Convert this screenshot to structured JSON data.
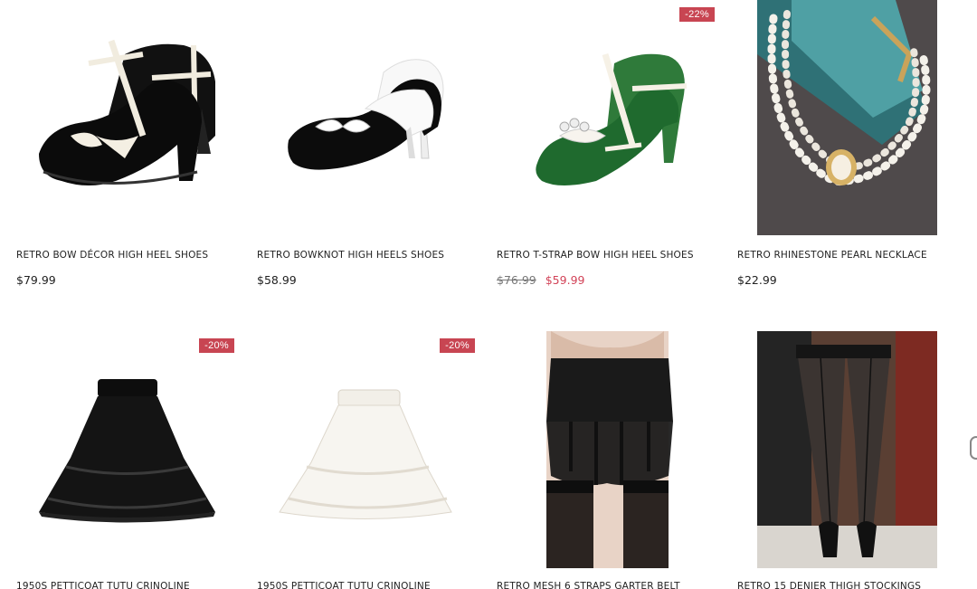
{
  "products": [
    {
      "title": "RETRO BOW DÉCOR HIGH HEEL SHOES",
      "price": "$79.99",
      "image": "black-cream-tstrap-heels"
    },
    {
      "title": "RETRO BOWKNOT HIGH HEELS SHOES",
      "price": "$58.99",
      "image": "black-white-bow-pumps"
    },
    {
      "title": "RETRO T-STRAP BOW HIGH HEEL SHOES",
      "old_price": "$76.99",
      "sale_price": "$59.99",
      "badge": "-22%",
      "image": "green-white-tstrap-heels"
    },
    {
      "title": "RETRO RHINESTONE PEARL NECKLACE",
      "price": "$22.99",
      "image": "pearl-necklace"
    },
    {
      "title": "1950S PETTICOAT TUTU CRINOLINE",
      "badge": "-20%",
      "image": "black-petticoat"
    },
    {
      "title": "1950S PETTICOAT TUTU CRINOLINE",
      "badge": "-20%",
      "image": "white-petticoat"
    },
    {
      "title": "RETRO MESH 6 STRAPS GARTER BELT",
      "image": "black-garter-belt"
    },
    {
      "title": "RETRO 15 DENIER THIGH STOCKINGS",
      "image": "seamed-stockings"
    }
  ],
  "colors": {
    "sale": "#d24358",
    "badge": "#c84552"
  }
}
